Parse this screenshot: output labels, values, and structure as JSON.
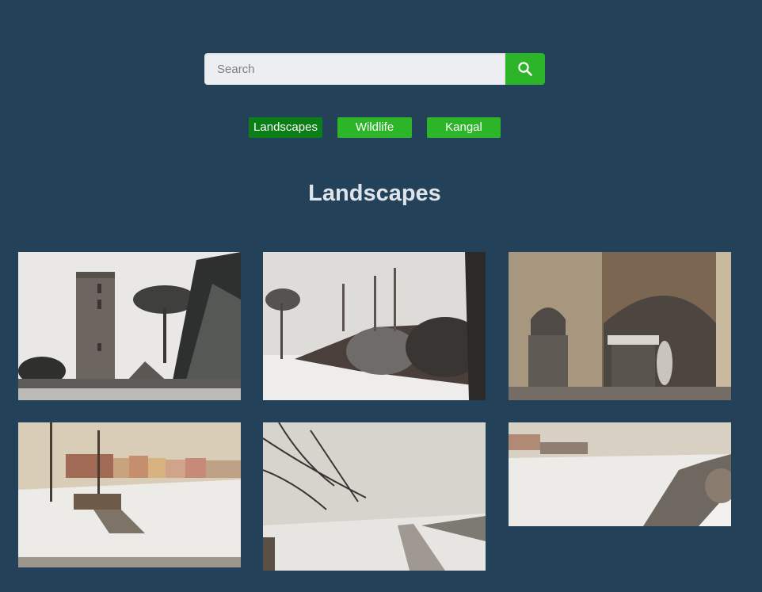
{
  "search": {
    "placeholder": "Search",
    "value": "",
    "button_icon": "search-icon"
  },
  "filters": [
    {
      "label": "Landscapes",
      "active": true
    },
    {
      "label": "Wildlife",
      "active": false
    },
    {
      "label": "Kangal",
      "active": false
    }
  ],
  "section_title": "Landscapes",
  "photos": [
    {
      "subject": "snowy-bell-tower"
    },
    {
      "subject": "snowy-park-wall"
    },
    {
      "subject": "snowy-arch-courtyard"
    },
    {
      "subject": "snowy-riverbank-town"
    },
    {
      "subject": "foggy-river-branches"
    },
    {
      "subject": "snowy-canal"
    }
  ],
  "colors": {
    "background": "#23425a",
    "accent": "#2db52a",
    "accent_active": "#0b7f17",
    "title": "#dfe4ea"
  }
}
